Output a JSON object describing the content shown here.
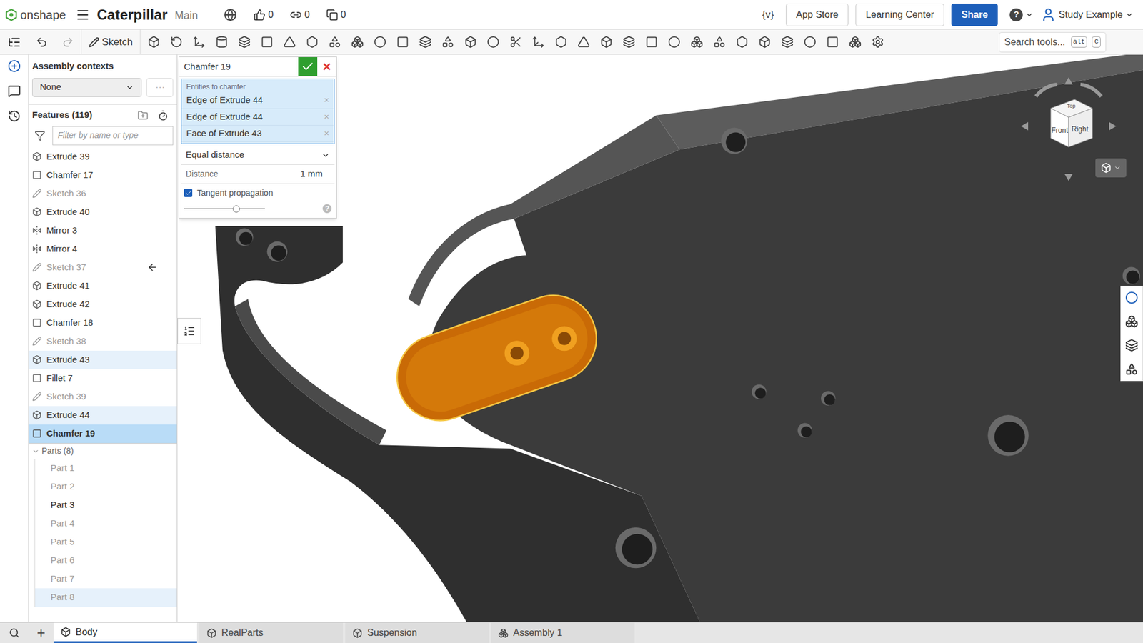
{
  "header": {
    "logo": "onshape",
    "title": "Caterpillar",
    "branch": "Main",
    "counts": [
      {
        "kind": "like",
        "value": "0"
      },
      {
        "kind": "link",
        "value": "0"
      },
      {
        "kind": "copy",
        "value": "0"
      }
    ],
    "variable_button": "{v}",
    "buttons": [
      {
        "label": "App Store",
        "primary": false
      },
      {
        "label": "Learning Center",
        "primary": false
      },
      {
        "label": "Share",
        "primary": true
      }
    ],
    "help": "?",
    "user": "Study Example"
  },
  "toolbar": {
    "sketch": "Sketch",
    "search": {
      "placeholder": "Search tools...",
      "keys": [
        "alt",
        "C"
      ]
    }
  },
  "assembly_contexts": {
    "label": "Assembly contexts",
    "value": "None",
    "more": "⋯"
  },
  "features": {
    "title": "Features (119)",
    "filter_placeholder": "Filter by name or type",
    "items": [
      {
        "name": "Extrude 39",
        "kind": "extrude",
        "dimmed": false,
        "highlighted": false,
        "selected": false,
        "rollback_marker": false
      },
      {
        "name": "Chamfer 17",
        "kind": "chamfer",
        "dimmed": false,
        "highlighted": false,
        "selected": false,
        "rollback_marker": false
      },
      {
        "name": "Sketch 36",
        "kind": "sketch",
        "dimmed": true,
        "highlighted": false,
        "selected": false,
        "rollback_marker": false
      },
      {
        "name": "Extrude 40",
        "kind": "extrude",
        "dimmed": false,
        "highlighted": false,
        "selected": false,
        "rollback_marker": false
      },
      {
        "name": "Mirror 3",
        "kind": "mirror",
        "dimmed": false,
        "highlighted": false,
        "selected": false,
        "rollback_marker": false
      },
      {
        "name": "Mirror 4",
        "kind": "mirror",
        "dimmed": false,
        "highlighted": false,
        "selected": false,
        "rollback_marker": false
      },
      {
        "name": "Sketch 37",
        "kind": "sketch",
        "dimmed": true,
        "highlighted": false,
        "selected": false,
        "rollback_marker": true
      },
      {
        "name": "Extrude 41",
        "kind": "extrude",
        "dimmed": false,
        "highlighted": false,
        "selected": false,
        "rollback_marker": false
      },
      {
        "name": "Extrude 42",
        "kind": "extrude",
        "dimmed": false,
        "highlighted": false,
        "selected": false,
        "rollback_marker": false
      },
      {
        "name": "Chamfer 18",
        "kind": "chamfer",
        "dimmed": false,
        "highlighted": false,
        "selected": false,
        "rollback_marker": false
      },
      {
        "name": "Sketch 38",
        "kind": "sketch",
        "dimmed": true,
        "highlighted": false,
        "selected": false,
        "rollback_marker": false
      },
      {
        "name": "Extrude 43",
        "kind": "extrude",
        "dimmed": false,
        "highlighted": true,
        "selected": false,
        "rollback_marker": false
      },
      {
        "name": "Fillet 7",
        "kind": "fillet",
        "dimmed": false,
        "highlighted": false,
        "selected": false,
        "rollback_marker": false
      },
      {
        "name": "Sketch 39",
        "kind": "sketch",
        "dimmed": true,
        "highlighted": false,
        "selected": false,
        "rollback_marker": false
      },
      {
        "name": "Extrude 44",
        "kind": "extrude",
        "dimmed": false,
        "highlighted": true,
        "selected": false,
        "rollback_marker": false
      },
      {
        "name": "Chamfer 19",
        "kind": "chamfer",
        "dimmed": false,
        "highlighted": false,
        "selected": true,
        "rollback_marker": false
      }
    ]
  },
  "parts": {
    "title": "Parts (8)",
    "items": [
      {
        "name": "Part 1",
        "dimmed": true,
        "highlighted": false
      },
      {
        "name": "Part 2",
        "dimmed": true,
        "highlighted": false
      },
      {
        "name": "Part 3",
        "dimmed": false,
        "highlighted": false
      },
      {
        "name": "Part 4",
        "dimmed": true,
        "highlighted": false
      },
      {
        "name": "Part 5",
        "dimmed": true,
        "highlighted": false
      },
      {
        "name": "Part 6",
        "dimmed": true,
        "highlighted": false
      },
      {
        "name": "Part 7",
        "dimmed": true,
        "highlighted": false
      },
      {
        "name": "Part 8",
        "dimmed": true,
        "highlighted": true
      }
    ]
  },
  "dialog": {
    "title": "Chamfer 19",
    "cancel": "×",
    "entities_label": "Entities to chamfer",
    "entities": [
      {
        "label": "Edge of Extrude 44",
        "remove": "×"
      },
      {
        "label": "Edge of Extrude 44",
        "remove": "×"
      },
      {
        "label": "Face of Extrude 43",
        "remove": "×"
      }
    ],
    "type": "Equal distance",
    "distance_label": "Distance",
    "distance_value": "1 mm",
    "tangent": {
      "label": "Tangent propagation",
      "checked": true
    },
    "slider": {
      "level": 0.65
    },
    "help": "?"
  },
  "view_cube": {
    "faces": [
      "Front",
      "Right",
      "Top"
    ]
  },
  "bottom_tabs": {
    "add": "+",
    "tabs": [
      {
        "label": "Body",
        "kind": "partstudio",
        "selected": true
      },
      {
        "label": "RealParts",
        "kind": "partstudio",
        "selected": false
      },
      {
        "label": "Suspension",
        "kind": "partstudio",
        "selected": false
      },
      {
        "label": "Assembly 1",
        "kind": "assembly",
        "selected": false
      }
    ]
  }
}
